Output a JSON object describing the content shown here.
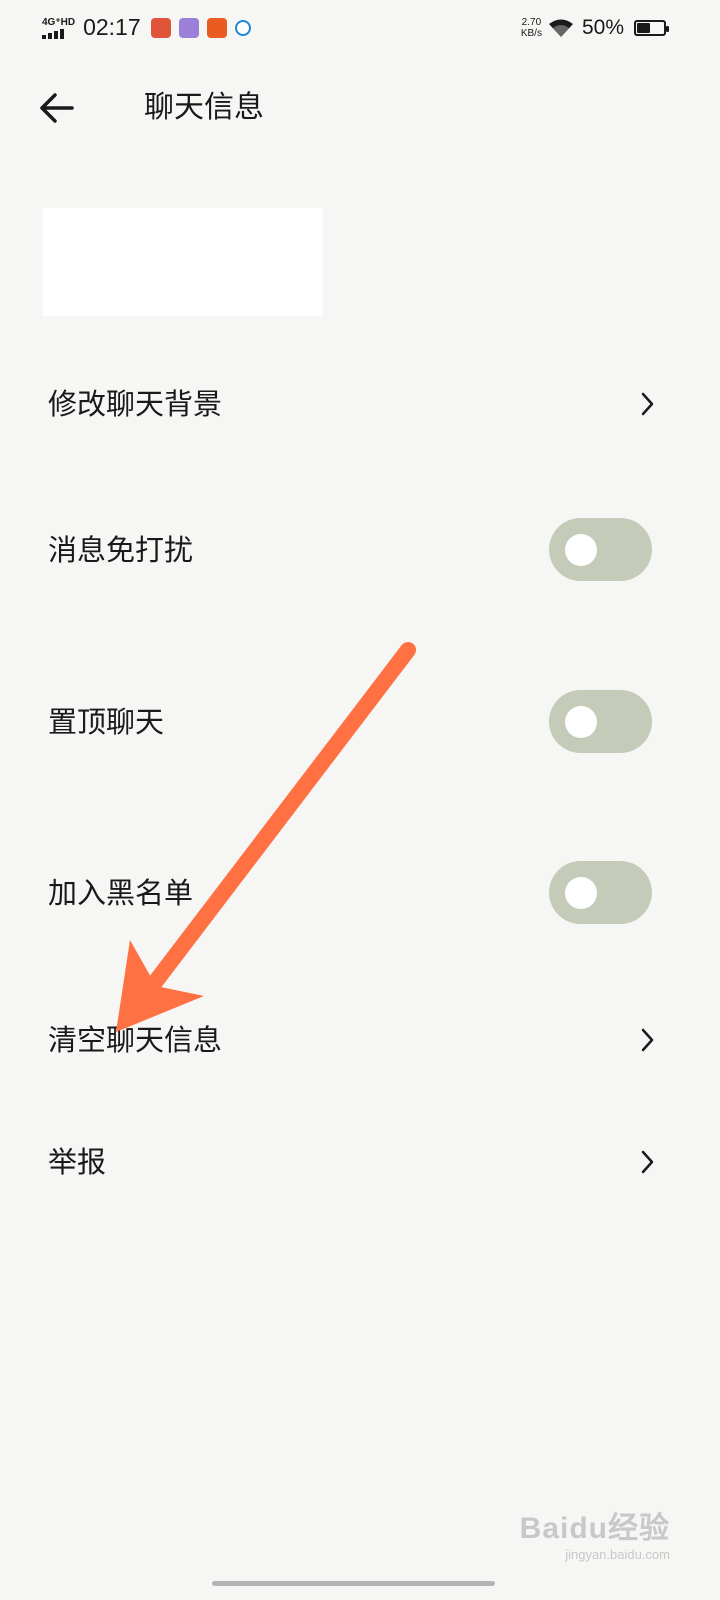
{
  "status_bar": {
    "network_label": "4G⁺HD",
    "time": "02:17",
    "speed_value": "2.70",
    "speed_unit": "KB/s",
    "battery_percent": "50%",
    "battery_level": 0.5,
    "app_icons": [
      "game-app-icon",
      "puzzle-app-icon",
      "video-app-icon",
      "browser-app-icon"
    ]
  },
  "header": {
    "back_icon": "arrow-left-icon",
    "title": "聊天信息"
  },
  "settings": {
    "rows": [
      {
        "label": "修改聊天背景",
        "type": "link"
      },
      {
        "label": "消息免打扰",
        "type": "toggle",
        "on": false
      },
      {
        "label": "置顶聊天",
        "type": "toggle",
        "on": false
      },
      {
        "label": "加入黑名单",
        "type": "toggle",
        "on": false
      },
      {
        "label": "清空聊天信息",
        "type": "link"
      },
      {
        "label": "举报",
        "type": "link"
      }
    ]
  },
  "colors": {
    "background": "#f6f6f4",
    "toggle_off": "#c5cbb9",
    "annotation_arrow": "#ff7043"
  },
  "watermark": {
    "brand": "Baidu经验",
    "url": "jingyan.baidu.com"
  }
}
